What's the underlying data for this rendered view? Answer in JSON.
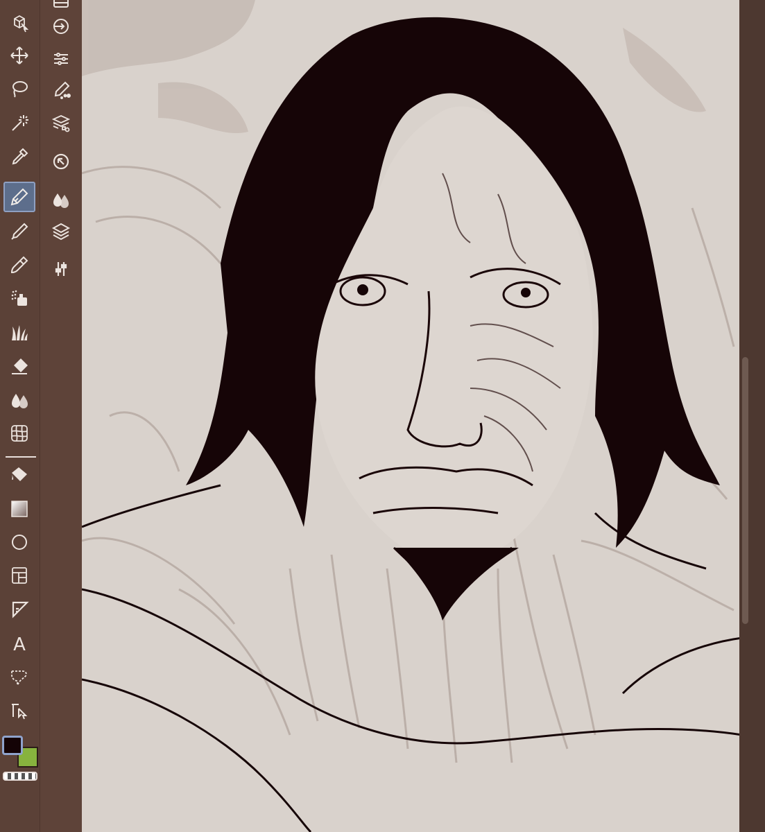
{
  "app": {
    "accent_color": "#5d6e8c",
    "panel_color": "#5b4137",
    "canvas_color": "#d9d2cc"
  },
  "toolbar": {
    "tools": [
      {
        "id": "object",
        "icon": "object-select-icon",
        "active": false
      },
      {
        "id": "move",
        "icon": "move-icon",
        "active": false
      },
      {
        "id": "lasso",
        "icon": "lasso-icon",
        "active": false
      },
      {
        "id": "magic-wand",
        "icon": "magic-wand-icon",
        "active": false
      },
      {
        "id": "eyedropper",
        "icon": "eyedropper-icon",
        "active": false
      },
      {
        "id": "pen",
        "icon": "pen-icon",
        "active": true
      },
      {
        "id": "pencil",
        "icon": "pencil-icon",
        "active": false
      },
      {
        "id": "brush",
        "icon": "brush-icon",
        "active": false
      },
      {
        "id": "airbrush",
        "icon": "airbrush-icon",
        "active": false
      },
      {
        "id": "decoration",
        "icon": "decoration-grass-icon",
        "active": false
      },
      {
        "id": "eraser",
        "icon": "eraser-icon",
        "active": false
      },
      {
        "id": "blend",
        "icon": "blend-drops-icon",
        "active": false
      },
      {
        "id": "mesh",
        "icon": "mesh-transform-icon",
        "active": false
      },
      {
        "id": "fill",
        "icon": "fill-bucket-icon",
        "active": false
      },
      {
        "id": "gradient",
        "icon": "gradient-icon",
        "active": false
      },
      {
        "id": "figure",
        "icon": "ellipse-figure-icon",
        "active": false
      },
      {
        "id": "frame",
        "icon": "frame-border-icon",
        "active": false
      },
      {
        "id": "ruler",
        "icon": "ruler-triangle-icon",
        "active": false
      },
      {
        "id": "text",
        "icon": "text-icon",
        "active": false,
        "glyph": "A"
      },
      {
        "id": "balloon",
        "icon": "balloon-icon",
        "active": false
      },
      {
        "id": "correct-line",
        "icon": "correct-line-icon",
        "active": false
      }
    ],
    "foreground_color": "#140306",
    "background_color": "#87b33e"
  },
  "subbar": {
    "items": [
      {
        "id": "history",
        "icon": "history-icon"
      },
      {
        "id": "navigator",
        "icon": "navigator-icon"
      },
      {
        "id": "tool-property",
        "icon": "tool-property-sliders-icon"
      },
      {
        "id": "brush-size",
        "icon": "brush-size-icon"
      },
      {
        "id": "material",
        "icon": "material-layers-icon"
      },
      {
        "id": "sub-view",
        "icon": "sub-view-icon"
      },
      {
        "id": "color-set",
        "icon": "color-drops-icon"
      },
      {
        "id": "layers",
        "icon": "layers-icon"
      },
      {
        "id": "layer-property",
        "icon": "layer-property-sliders-icon"
      }
    ]
  }
}
